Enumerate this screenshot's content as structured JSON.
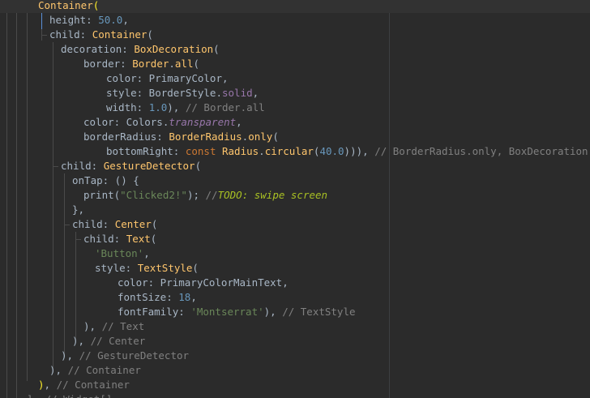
{
  "editor": {
    "lines": [
      [
        {
          "t": "Container",
          "c": "tok-class"
        },
        {
          "t": "(",
          "c": "tok-paren"
        }
      ],
      [
        {
          "t": "height: ",
          "c": "tok-text"
        },
        {
          "t": "50.0",
          "c": "tok-num"
        },
        {
          "t": ",",
          "c": "tok-text"
        }
      ],
      [
        {
          "t": "child: ",
          "c": "tok-text"
        },
        {
          "t": "Container",
          "c": "tok-class"
        },
        {
          "t": "(",
          "c": "tok-text"
        }
      ],
      [
        {
          "t": "decoration: ",
          "c": "tok-text"
        },
        {
          "t": "BoxDecoration",
          "c": "tok-class"
        },
        {
          "t": "(",
          "c": "tok-text"
        }
      ],
      [
        {
          "t": "border: ",
          "c": "tok-text"
        },
        {
          "t": "Border",
          "c": "tok-class"
        },
        {
          "t": ".",
          "c": "tok-text"
        },
        {
          "t": "all",
          "c": "tok-class"
        },
        {
          "t": "(",
          "c": "tok-text"
        }
      ],
      [
        {
          "t": "color: PrimaryColor,",
          "c": "tok-text"
        }
      ],
      [
        {
          "t": "style: BorderStyle.",
          "c": "tok-text"
        },
        {
          "t": "solid",
          "c": "tok-prop"
        },
        {
          "t": ",",
          "c": "tok-text"
        }
      ],
      [
        {
          "t": "width: ",
          "c": "tok-text"
        },
        {
          "t": "1.0",
          "c": "tok-num"
        },
        {
          "t": "), ",
          "c": "tok-text"
        },
        {
          "t": "// Border.all",
          "c": "tok-comment"
        }
      ],
      [
        {
          "t": "color: Colors.",
          "c": "tok-text"
        },
        {
          "t": "transparent",
          "c": "tok-italic"
        },
        {
          "t": ",",
          "c": "tok-text"
        }
      ],
      [
        {
          "t": "borderRadius: ",
          "c": "tok-text"
        },
        {
          "t": "BorderRadius",
          "c": "tok-class"
        },
        {
          "t": ".",
          "c": "tok-text"
        },
        {
          "t": "only",
          "c": "tok-class"
        },
        {
          "t": "(",
          "c": "tok-text"
        }
      ],
      [
        {
          "t": "bottomRight: ",
          "c": "tok-text"
        },
        {
          "t": "const ",
          "c": "tok-kw"
        },
        {
          "t": "Radius",
          "c": "tok-class"
        },
        {
          "t": ".",
          "c": "tok-text"
        },
        {
          "t": "circular",
          "c": "tok-class"
        },
        {
          "t": "(",
          "c": "tok-text"
        },
        {
          "t": "40.0",
          "c": "tok-num"
        },
        {
          "t": "))), ",
          "c": "tok-text"
        },
        {
          "t": "// BorderRadius.only, BoxDecoration",
          "c": "tok-comment"
        }
      ],
      [
        {
          "t": "child: ",
          "c": "tok-text"
        },
        {
          "t": "GestureDetector",
          "c": "tok-class"
        },
        {
          "t": "(",
          "c": "tok-text"
        }
      ],
      [
        {
          "t": "onTap: () {",
          "c": "tok-text"
        }
      ],
      [
        {
          "t": "print(",
          "c": "tok-text"
        },
        {
          "t": "\"Clicked2!\"",
          "c": "tok-str"
        },
        {
          "t": "); ",
          "c": "tok-text"
        },
        {
          "t": "//",
          "c": "tok-comment"
        },
        {
          "t": "TODO: swipe screen",
          "c": "tok-todo"
        }
      ],
      [
        {
          "t": "},",
          "c": "tok-text"
        }
      ],
      [
        {
          "t": "child: ",
          "c": "tok-text"
        },
        {
          "t": "Center",
          "c": "tok-class"
        },
        {
          "t": "(",
          "c": "tok-text"
        }
      ],
      [
        {
          "t": "child: ",
          "c": "tok-text"
        },
        {
          "t": "Text",
          "c": "tok-class"
        },
        {
          "t": "(",
          "c": "tok-text"
        }
      ],
      [
        {
          "t": "'Button'",
          "c": "tok-str"
        },
        {
          "t": ",",
          "c": "tok-text"
        }
      ],
      [
        {
          "t": "style: ",
          "c": "tok-text"
        },
        {
          "t": "TextStyle",
          "c": "tok-class"
        },
        {
          "t": "(",
          "c": "tok-text"
        }
      ],
      [
        {
          "t": "color: PrimaryColorMainText,",
          "c": "tok-text"
        }
      ],
      [
        {
          "t": "fontSize: ",
          "c": "tok-text"
        },
        {
          "t": "18",
          "c": "tok-num"
        },
        {
          "t": ",",
          "c": "tok-text"
        }
      ],
      [
        {
          "t": "fontFamily: ",
          "c": "tok-text"
        },
        {
          "t": "'Montserrat'",
          "c": "tok-str"
        },
        {
          "t": "), ",
          "c": "tok-text"
        },
        {
          "t": "// TextStyle",
          "c": "tok-comment"
        }
      ],
      [
        {
          "t": "), ",
          "c": "tok-text"
        },
        {
          "t": "// Text",
          "c": "tok-comment"
        }
      ],
      [
        {
          "t": "), ",
          "c": "tok-text"
        },
        {
          "t": "// Center",
          "c": "tok-comment"
        }
      ],
      [
        {
          "t": "), ",
          "c": "tok-text"
        },
        {
          "t": "// GestureDetector",
          "c": "tok-comment"
        }
      ],
      [
        {
          "t": "), ",
          "c": "tok-text"
        },
        {
          "t": "// Container",
          "c": "tok-comment"
        }
      ],
      [
        {
          "t": ")",
          "c": "tok-paren"
        },
        {
          "t": ", ",
          "c": "tok-text"
        },
        {
          "t": "// Container",
          "c": "tok-comment"
        }
      ],
      [
        {
          "t": "], // Widget[]",
          "c": "tok-comment"
        }
      ]
    ]
  }
}
